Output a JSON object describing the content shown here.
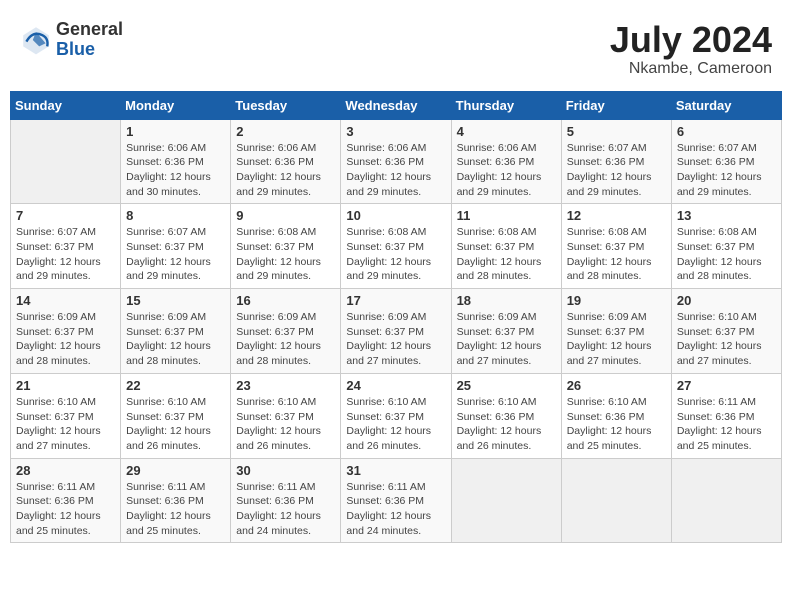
{
  "header": {
    "logo_general": "General",
    "logo_blue": "Blue",
    "month_year": "July 2024",
    "location": "Nkambe, Cameroon"
  },
  "days_of_week": [
    "Sunday",
    "Monday",
    "Tuesday",
    "Wednesday",
    "Thursday",
    "Friday",
    "Saturday"
  ],
  "weeks": [
    [
      {
        "day": "",
        "info": ""
      },
      {
        "day": "1",
        "info": "Sunrise: 6:06 AM\nSunset: 6:36 PM\nDaylight: 12 hours\nand 30 minutes."
      },
      {
        "day": "2",
        "info": "Sunrise: 6:06 AM\nSunset: 6:36 PM\nDaylight: 12 hours\nand 29 minutes."
      },
      {
        "day": "3",
        "info": "Sunrise: 6:06 AM\nSunset: 6:36 PM\nDaylight: 12 hours\nand 29 minutes."
      },
      {
        "day": "4",
        "info": "Sunrise: 6:06 AM\nSunset: 6:36 PM\nDaylight: 12 hours\nand 29 minutes."
      },
      {
        "day": "5",
        "info": "Sunrise: 6:07 AM\nSunset: 6:36 PM\nDaylight: 12 hours\nand 29 minutes."
      },
      {
        "day": "6",
        "info": "Sunrise: 6:07 AM\nSunset: 6:36 PM\nDaylight: 12 hours\nand 29 minutes."
      }
    ],
    [
      {
        "day": "7",
        "info": "Sunrise: 6:07 AM\nSunset: 6:37 PM\nDaylight: 12 hours\nand 29 minutes."
      },
      {
        "day": "8",
        "info": "Sunrise: 6:07 AM\nSunset: 6:37 PM\nDaylight: 12 hours\nand 29 minutes."
      },
      {
        "day": "9",
        "info": "Sunrise: 6:08 AM\nSunset: 6:37 PM\nDaylight: 12 hours\nand 29 minutes."
      },
      {
        "day": "10",
        "info": "Sunrise: 6:08 AM\nSunset: 6:37 PM\nDaylight: 12 hours\nand 29 minutes."
      },
      {
        "day": "11",
        "info": "Sunrise: 6:08 AM\nSunset: 6:37 PM\nDaylight: 12 hours\nand 28 minutes."
      },
      {
        "day": "12",
        "info": "Sunrise: 6:08 AM\nSunset: 6:37 PM\nDaylight: 12 hours\nand 28 minutes."
      },
      {
        "day": "13",
        "info": "Sunrise: 6:08 AM\nSunset: 6:37 PM\nDaylight: 12 hours\nand 28 minutes."
      }
    ],
    [
      {
        "day": "14",
        "info": "Sunrise: 6:09 AM\nSunset: 6:37 PM\nDaylight: 12 hours\nand 28 minutes."
      },
      {
        "day": "15",
        "info": "Sunrise: 6:09 AM\nSunset: 6:37 PM\nDaylight: 12 hours\nand 28 minutes."
      },
      {
        "day": "16",
        "info": "Sunrise: 6:09 AM\nSunset: 6:37 PM\nDaylight: 12 hours\nand 28 minutes."
      },
      {
        "day": "17",
        "info": "Sunrise: 6:09 AM\nSunset: 6:37 PM\nDaylight: 12 hours\nand 27 minutes."
      },
      {
        "day": "18",
        "info": "Sunrise: 6:09 AM\nSunset: 6:37 PM\nDaylight: 12 hours\nand 27 minutes."
      },
      {
        "day": "19",
        "info": "Sunrise: 6:09 AM\nSunset: 6:37 PM\nDaylight: 12 hours\nand 27 minutes."
      },
      {
        "day": "20",
        "info": "Sunrise: 6:10 AM\nSunset: 6:37 PM\nDaylight: 12 hours\nand 27 minutes."
      }
    ],
    [
      {
        "day": "21",
        "info": "Sunrise: 6:10 AM\nSunset: 6:37 PM\nDaylight: 12 hours\nand 27 minutes."
      },
      {
        "day": "22",
        "info": "Sunrise: 6:10 AM\nSunset: 6:37 PM\nDaylight: 12 hours\nand 26 minutes."
      },
      {
        "day": "23",
        "info": "Sunrise: 6:10 AM\nSunset: 6:37 PM\nDaylight: 12 hours\nand 26 minutes."
      },
      {
        "day": "24",
        "info": "Sunrise: 6:10 AM\nSunset: 6:37 PM\nDaylight: 12 hours\nand 26 minutes."
      },
      {
        "day": "25",
        "info": "Sunrise: 6:10 AM\nSunset: 6:36 PM\nDaylight: 12 hours\nand 26 minutes."
      },
      {
        "day": "26",
        "info": "Sunrise: 6:10 AM\nSunset: 6:36 PM\nDaylight: 12 hours\nand 25 minutes."
      },
      {
        "day": "27",
        "info": "Sunrise: 6:11 AM\nSunset: 6:36 PM\nDaylight: 12 hours\nand 25 minutes."
      }
    ],
    [
      {
        "day": "28",
        "info": "Sunrise: 6:11 AM\nSunset: 6:36 PM\nDaylight: 12 hours\nand 25 minutes."
      },
      {
        "day": "29",
        "info": "Sunrise: 6:11 AM\nSunset: 6:36 PM\nDaylight: 12 hours\nand 25 minutes."
      },
      {
        "day": "30",
        "info": "Sunrise: 6:11 AM\nSunset: 6:36 PM\nDaylight: 12 hours\nand 24 minutes."
      },
      {
        "day": "31",
        "info": "Sunrise: 6:11 AM\nSunset: 6:36 PM\nDaylight: 12 hours\nand 24 minutes."
      },
      {
        "day": "",
        "info": ""
      },
      {
        "day": "",
        "info": ""
      },
      {
        "day": "",
        "info": ""
      }
    ]
  ]
}
